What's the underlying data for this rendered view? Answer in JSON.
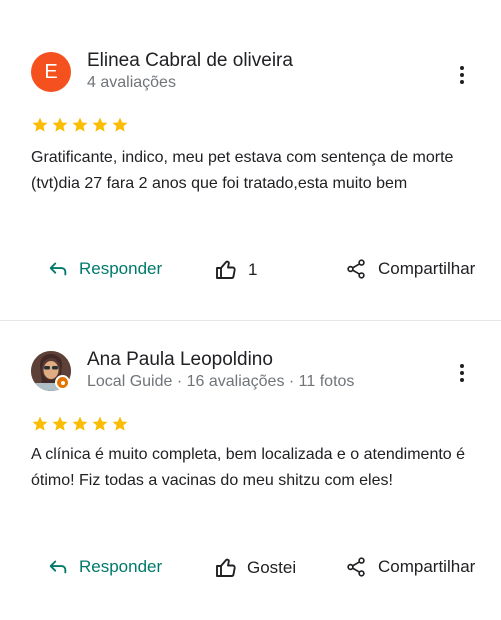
{
  "reviews": [
    {
      "avatar_letter": "E",
      "avatar_color": "#f4511e",
      "name": "Elinea Cabral de oliveira",
      "meta": "4 avaliações",
      "rating": 5,
      "text": "Gratificante, indico, meu pet estava com sentença de morte (tvt)dia 27 fara 2 anos que foi tratado,esta muito bem",
      "reply_label": "Responder",
      "like_label": "1",
      "share_label": "Compartilhar"
    },
    {
      "avatar_letter": "",
      "avatar_color": "#8d6e63",
      "name": "Ana Paula Leopoldino",
      "meta": "Local Guide · 16 avaliações · 11 fotos",
      "rating": 5,
      "text": "A clínica é muito completa, bem localizada e o atendimento é ótimo! Fiz todas a vacinas do meu shitzu com eles!",
      "reply_label": "Responder",
      "like_label": "Gostei",
      "share_label": "Compartilhar"
    }
  ],
  "colors": {
    "star": "#fbbc04",
    "reply": "#00796b",
    "local_guide_badge": "#e37400"
  },
  "icons": {
    "reply": "reply-arrow-icon",
    "like": "thumb-up-icon",
    "share": "share-icon",
    "more": "more-vert-icon",
    "star": "star-icon"
  }
}
